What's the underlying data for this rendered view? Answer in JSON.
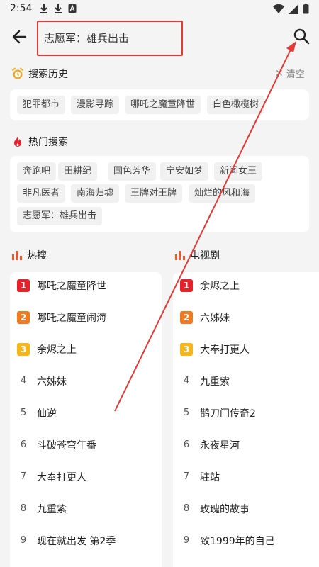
{
  "status_bar": {
    "time": "2:54",
    "left_icons": [
      "download-icon",
      "download-icon",
      "a-icon"
    ],
    "right_icons": [
      "wifi-icon",
      "signal-icon",
      "battery-icon"
    ]
  },
  "search": {
    "query": "志愿军：雄兵出击"
  },
  "history": {
    "title": "搜索历史",
    "clear_label": "清空",
    "items": [
      "犯罪都市",
      "漫影寻踪",
      "哪吒之魔童降世",
      "白色橄榄树"
    ]
  },
  "hot_search": {
    "title": "热门搜索",
    "items": [
      "奔跑吧",
      "田耕纪",
      "国色芳华",
      "宁安如梦",
      "新闻女王",
      "非凡医者",
      "南海归墟",
      "王牌对王牌",
      "灿烂的风和海",
      "志愿军：雄兵出击"
    ]
  },
  "trending": {
    "title": "热搜",
    "items": [
      {
        "rank": "1",
        "title": "哪吒之魔童降世"
      },
      {
        "rank": "2",
        "title": "哪吒之魔童闹海"
      },
      {
        "rank": "3",
        "title": "余烬之上"
      },
      {
        "rank": "4",
        "title": "六姊妹"
      },
      {
        "rank": "5",
        "title": "仙逆"
      },
      {
        "rank": "6",
        "title": "斗破苍穹年番"
      },
      {
        "rank": "7",
        "title": "大奉打更人"
      },
      {
        "rank": "8",
        "title": "九重紫"
      },
      {
        "rank": "9",
        "title": "现在就出发 第2季"
      }
    ]
  },
  "tv_series": {
    "title": "电视剧",
    "items": [
      {
        "rank": "1",
        "title": "余烬之上"
      },
      {
        "rank": "2",
        "title": "六姊妹"
      },
      {
        "rank": "3",
        "title": "大奉打更人"
      },
      {
        "rank": "4",
        "title": "九重紫"
      },
      {
        "rank": "5",
        "title": "鹊刀门传奇2"
      },
      {
        "rank": "6",
        "title": "永夜星河"
      },
      {
        "rank": "7",
        "title": "驻站"
      },
      {
        "rank": "8",
        "title": "玫瑰的故事"
      },
      {
        "rank": "9",
        "title": "致1999年的自己"
      }
    ]
  },
  "colors": {
    "highlight_red": "#e53935",
    "rank1": "#e8202a",
    "rank2": "#f07a22",
    "rank3": "#f5b51b",
    "bar_icon": "#f0562a"
  }
}
